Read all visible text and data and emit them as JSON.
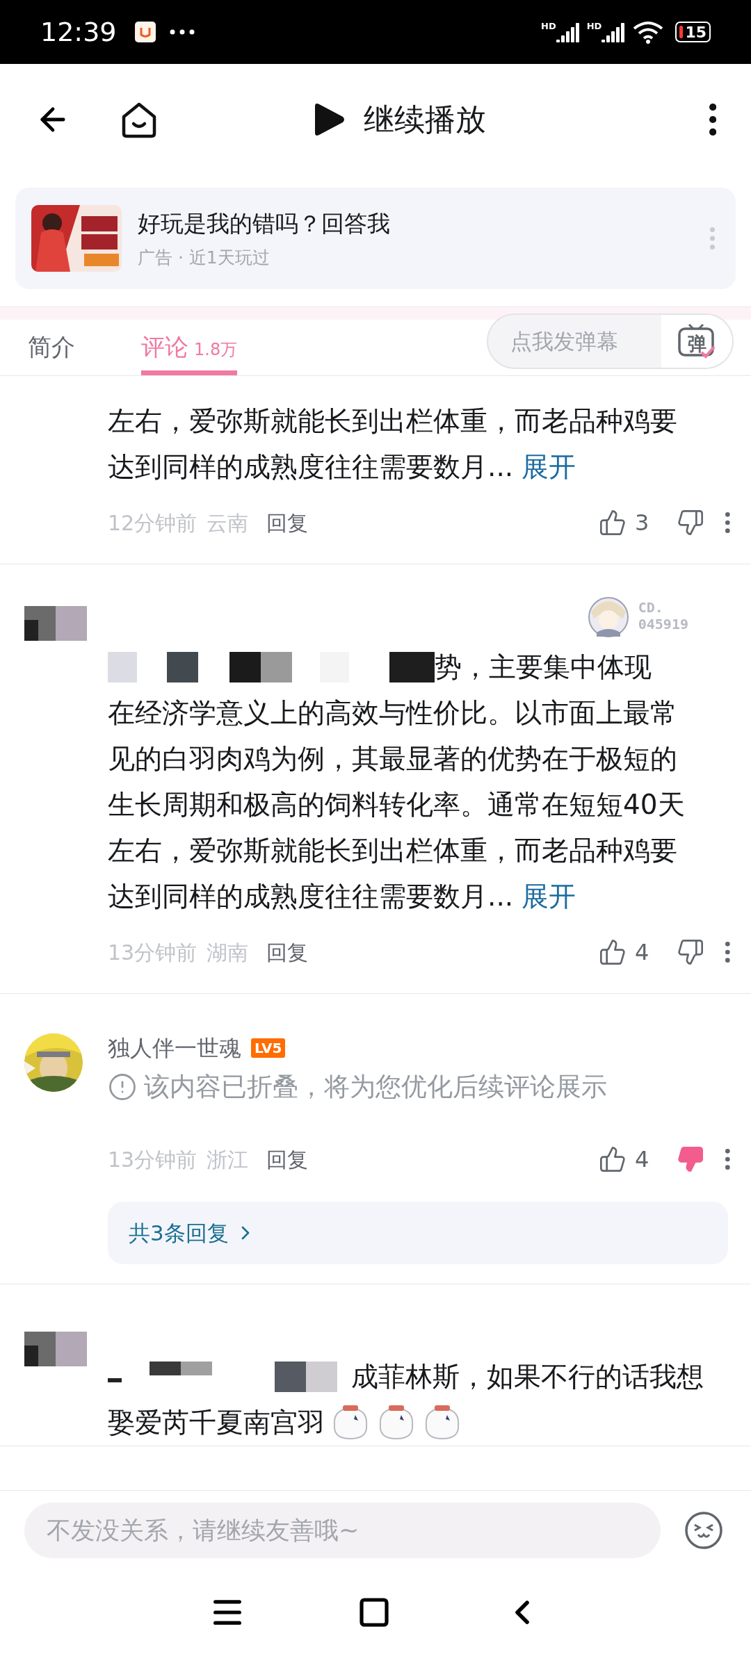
{
  "status_bar": {
    "time": "12:39",
    "signals": [
      {
        "label": "HD"
      },
      {
        "label": "HD"
      }
    ],
    "battery": "15"
  },
  "nav": {
    "title": "继续播放"
  },
  "ad": {
    "title": "好玩是我的错吗？回答我",
    "subtitle": "广告 · 近1天玩过"
  },
  "tabs": [
    {
      "label": "简介",
      "selected": false
    },
    {
      "label": "评论",
      "count": "1.8万",
      "selected": true
    }
  ],
  "danmaku": {
    "placeholder": "点我发弹幕",
    "button": "弹"
  },
  "comments": [
    {
      "kind": "text",
      "lines": [
        {
          "text": "左右，爱弥斯就能长到出栏体重，而老品种鸡要",
          "redacted": false
        },
        {
          "text": "达到同样的成熟度往往需要数月...",
          "redacted": false
        }
      ],
      "expand": "展开",
      "time": "12分钟前",
      "region": "云南",
      "reply": "回复",
      "likes": "3",
      "disliked": false
    },
    {
      "kind": "text",
      "avatar": {
        "kind": "redacted"
      },
      "badge": {
        "label": "CD.",
        "number": "045919"
      },
      "lines": [
        {
          "text": "势，主要集中体现",
          "redacted": true
        },
        {
          "text": "在经济学意义上的高效与性价比。以市面上最常",
          "redacted": false
        },
        {
          "text": "见的白羽肉鸡为例，其最显著的优势在于极短的",
          "redacted": false
        },
        {
          "text": "生长周期和极高的饲料转化率。通常在短短40天",
          "redacted": false
        },
        {
          "text": "左右，爱弥斯就能长到出栏体重，而老品种鸡要",
          "redacted": false
        },
        {
          "text": "达到同样的成熟度往往需要数月...",
          "redacted": false
        }
      ],
      "expand": "展开",
      "time": "13分钟前",
      "region": "湖南",
      "reply": "回复",
      "likes": "4",
      "disliked": false
    },
    {
      "kind": "folded",
      "name": "独人伴一世魂",
      "level_badge": "LV5",
      "notice": "该内容已折叠，将为您优化后续评论展示",
      "time": "13分钟前",
      "region": "浙江",
      "reply": "回复",
      "likes": "4",
      "disliked": true,
      "replies": "共3条回复"
    },
    {
      "kind": "text",
      "avatar": {
        "kind": "redacted"
      },
      "lines": [
        {
          "text": "成菲林斯，如果不行的话我想",
          "redacted": true
        },
        {
          "text": "娶爱芮千夏南宫羽",
          "redacted": false,
          "stickers": [
            {
              "kind": "sticker"
            },
            {
              "kind": "sticker"
            },
            {
              "kind": "sticker"
            }
          ]
        }
      ]
    }
  ],
  "input": {
    "placeholder": "不发没关系，请继续友善哦~"
  }
}
